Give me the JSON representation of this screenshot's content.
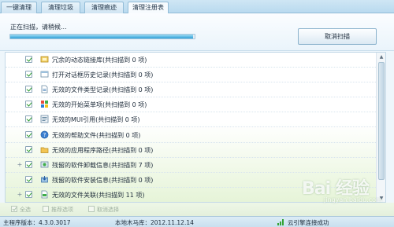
{
  "tabs": [
    {
      "label": "一键清理",
      "active": false
    },
    {
      "label": "清理垃圾",
      "active": false
    },
    {
      "label": "清理痕迹",
      "active": false
    },
    {
      "label": "清理注册表",
      "active": true
    }
  ],
  "scan": {
    "status": "正在扫描，请稍候...",
    "progress_fraction": 0.99,
    "cancel_label": "取消扫描"
  },
  "items": [
    {
      "label": "冗余的动态链接库(共扫描到 0 项)",
      "icon": "dll-icon",
      "expandable": false
    },
    {
      "label": "打开对话框历史记录(共扫描到 0 项)",
      "icon": "dialog-history-icon",
      "expandable": false
    },
    {
      "label": "无效的文件类型记录(共扫描到 0 项)",
      "icon": "file-type-icon",
      "expandable": false
    },
    {
      "label": "无效的开始菜单项(共扫描到 0 项)",
      "icon": "start-menu-icon",
      "expandable": false
    },
    {
      "label": "无效的MUI引用(共扫描到 0 项)",
      "icon": "mui-icon",
      "expandable": false
    },
    {
      "label": "无效的帮助文件(共扫描到 0 项)",
      "icon": "help-icon",
      "expandable": false
    },
    {
      "label": "无效的应用程序路径(共扫描到 0 项)",
      "icon": "folder-icon",
      "expandable": false
    },
    {
      "label": "残留的软件卸载信息(共扫描到 7 项)",
      "icon": "uninstall-icon",
      "expandable": true
    },
    {
      "label": "残留的软件安装信息(共扫描到 0 项)",
      "icon": "install-icon",
      "expandable": false
    },
    {
      "label": "无效的文件关联(共扫描到 11 项)",
      "icon": "file-assoc-icon",
      "expandable": true
    }
  ],
  "options": [
    {
      "label": "全选",
      "checked": true
    },
    {
      "label": "推荐选项",
      "checked": false
    },
    {
      "label": "取消选择",
      "checked": false
    }
  ],
  "footer": {
    "main_version": "主程序版本：4.3.0.3017",
    "library_version": "本地木马库：2012.11.12.14",
    "connection": "云引擎连接成功"
  },
  "watermark": {
    "brand": "Bai 经验",
    "domain": "jingyan.baidu.com"
  },
  "colors": {
    "accent": "#2d9fd6",
    "check": "#2a9a2a"
  }
}
